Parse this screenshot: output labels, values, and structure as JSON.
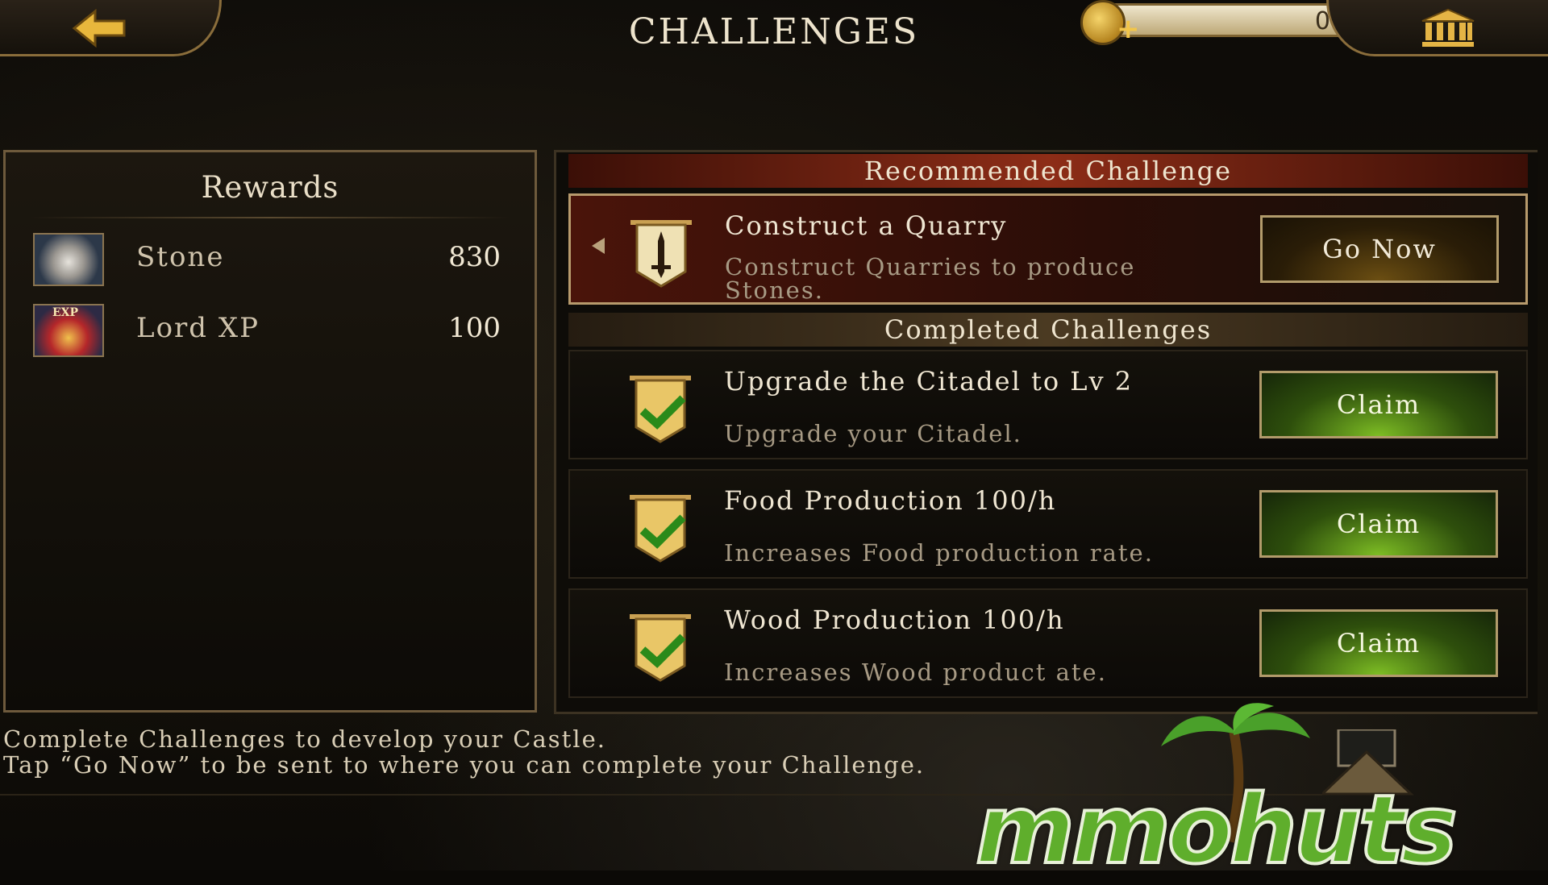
{
  "topbar": {
    "title": "CHALLENGES",
    "currency": {
      "value": "0"
    }
  },
  "rewards": {
    "title": "Rewards",
    "items": [
      {
        "icon": "stone-icon",
        "name": "Stone",
        "amount": "830"
      },
      {
        "icon": "lord-xp-crown-icon",
        "icon_tag": "EXP",
        "name": "Lord XP",
        "amount": "100"
      }
    ]
  },
  "challenges": {
    "recommended_header": "Recommended Challenge",
    "recommended": {
      "title": "Construct a Quarry",
      "description": "Construct Quarries to produce Stones.",
      "button": "Go Now"
    },
    "completed_header": "Completed Challenges",
    "completed": [
      {
        "title": "Upgrade the Citadel to Lv 2",
        "description": "Upgrade your Citadel.",
        "button": "Claim"
      },
      {
        "title": "Food Production 100/h",
        "description": "Increases Food production rate.",
        "button": "Claim"
      },
      {
        "title": "Wood Production 100/h",
        "description": "Increases Wood product ate.",
        "button": "Claim"
      }
    ]
  },
  "footer": {
    "line1": "Complete Challenges to develop your Castle.",
    "line2": "Tap “Go Now” to be sent to where you can complete your Challenge."
  },
  "watermark": {
    "text": "mmohuts"
  },
  "colors": {
    "gold_border": "#b29b6b",
    "claim_green": "#7dbd24",
    "recommended_red": "#8d2d17"
  }
}
